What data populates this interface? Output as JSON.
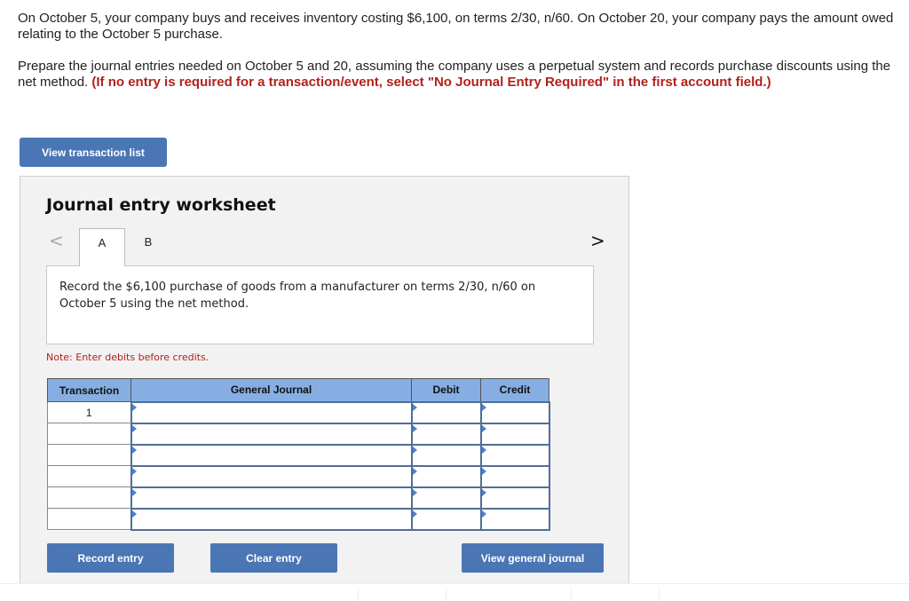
{
  "prompt": {
    "paragraph1": "On October 5, your company buys and receives inventory costing $6,100, on terms 2/30, n/60. On October 20, your company pays the amount owed relating to the October 5 purchase.",
    "paragraph2_plain": "Prepare the journal entries needed on October 5 and 20, assuming the company uses a perpetual system and records purchase discounts using the net method. ",
    "paragraph2_red": "(If no entry is required for a transaction/event, select \"No Journal Entry Required\" in the first account field.)"
  },
  "buttons": {
    "view_transaction_list": "View transaction list",
    "record_entry": "Record entry",
    "clear_entry": "Clear entry",
    "view_general_journal": "View general journal"
  },
  "worksheet": {
    "title": "Journal entry worksheet",
    "prev_icon": "<",
    "next_icon": ">",
    "tabs": [
      {
        "label": "A",
        "active": true
      },
      {
        "label": "B",
        "active": false
      }
    ],
    "description": "Record the $6,100 purchase of goods from a manufacturer on terms 2/30, n/60 on October 5 using the net method.",
    "note": "Note: Enter debits before credits.",
    "table": {
      "headers": [
        "Transaction",
        "General Journal",
        "Debit",
        "Credit"
      ],
      "rows": [
        {
          "transaction": "1",
          "account": "",
          "debit": "",
          "credit": ""
        },
        {
          "transaction": "",
          "account": "",
          "debit": "",
          "credit": ""
        },
        {
          "transaction": "",
          "account": "",
          "debit": "",
          "credit": ""
        },
        {
          "transaction": "",
          "account": "",
          "debit": "",
          "credit": ""
        },
        {
          "transaction": "",
          "account": "",
          "debit": "",
          "credit": ""
        },
        {
          "transaction": "",
          "account": "",
          "debit": "",
          "credit": ""
        }
      ]
    }
  },
  "colors": {
    "accent": "#4a76b5",
    "header": "#86aee2",
    "warning": "#b2211b"
  }
}
